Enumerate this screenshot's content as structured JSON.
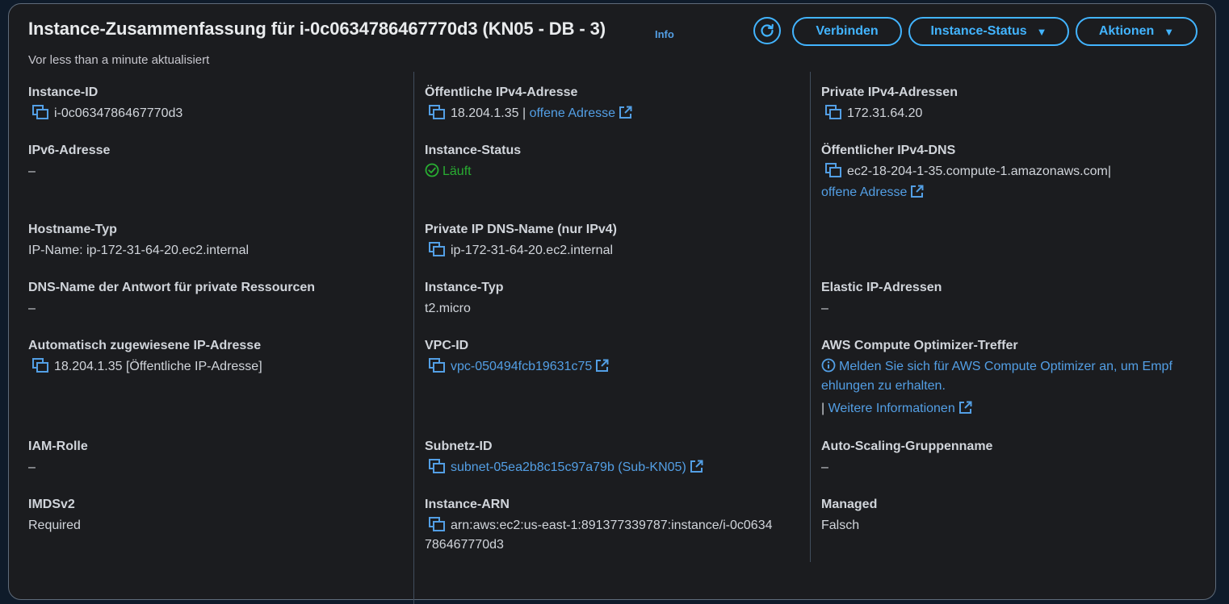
{
  "header": {
    "title": "Instance-Zusammenfassung für i-0c0634786467770d3 (KN05 - DB - 3)",
    "info_label": "Info",
    "subtitle": "Vor less than a minute aktualisiert",
    "buttons": {
      "connect": "Verbinden",
      "instance_status": "Instance-Status",
      "actions": "Aktionen"
    }
  },
  "fields": {
    "instance_id": {
      "label": "Instance-ID",
      "value": "i-0c0634786467770d3"
    },
    "public_ipv4": {
      "label": "Öffentliche IPv4-Adresse",
      "value": "18.204.1.35",
      "sep": "|",
      "link": "offene Adresse"
    },
    "private_ipv4": {
      "label": "Private IPv4-Adressen",
      "value": "172.31.64.20"
    },
    "ipv6": {
      "label": "IPv6-Adresse",
      "value": "–"
    },
    "instance_state": {
      "label": "Instance-Status",
      "value": "Läuft"
    },
    "public_dns": {
      "label": "Öffentlicher IPv4-DNS",
      "value": "ec2-18-204-1-35.compute-1.amazonaws.com",
      "sep": "|",
      "link": "offene Adresse"
    },
    "hostname_type": {
      "label": "Hostname-Typ",
      "value": "IP-Name: ip-172-31-64-20.ec2.internal"
    },
    "private_dns": {
      "label": "Private IP DNS-Name (nur IPv4)",
      "value": "ip-172-31-64-20.ec2.internal"
    },
    "dns_answer": {
      "label": "DNS-Name der Antwort für private Ressourcen",
      "value": "–"
    },
    "instance_type": {
      "label": "Instance-Typ",
      "value": "t2.micro"
    },
    "elastic_ip": {
      "label": "Elastic IP-Adressen",
      "value": "–"
    },
    "auto_ip": {
      "label": "Automatisch zugewiesene IP-Adresse",
      "value": "18.204.1.35 [Öffentliche IP-Adresse]"
    },
    "vpc_id": {
      "label": "VPC-ID",
      "value": "vpc-050494fcb19631c75"
    },
    "optimizer": {
      "label": "AWS Compute Optimizer-Treffer",
      "line1": "Melden Sie sich für AWS Compute Optimizer an, um Empf",
      "line2": "ehlungen zu erhalten.",
      "sep": "|",
      "more": "Weitere Informationen"
    },
    "iam_role": {
      "label": "IAM-Rolle",
      "value": "–"
    },
    "subnet_id": {
      "label": "Subnetz-ID",
      "value": "subnet-05ea2b8c15c97a79b (Sub-KN05)"
    },
    "asg_name": {
      "label": "Auto-Scaling-Gruppenname",
      "value": "–"
    },
    "imdsv2": {
      "label": "IMDSv2",
      "value": "Required"
    },
    "instance_arn": {
      "label": "Instance-ARN",
      "line1": "arn:aws:ec2:us-east-1:891377339787:instance/i-0c0634",
      "line2": "786467770d3"
    },
    "managed": {
      "label": "Managed",
      "value": "Falsch"
    }
  },
  "colors": {
    "background": "#1b1c1f",
    "text": "#d1d5db",
    "link": "#539fe5",
    "button": "#42b4ff",
    "success": "#29ad32",
    "divider": "#414d5c"
  }
}
